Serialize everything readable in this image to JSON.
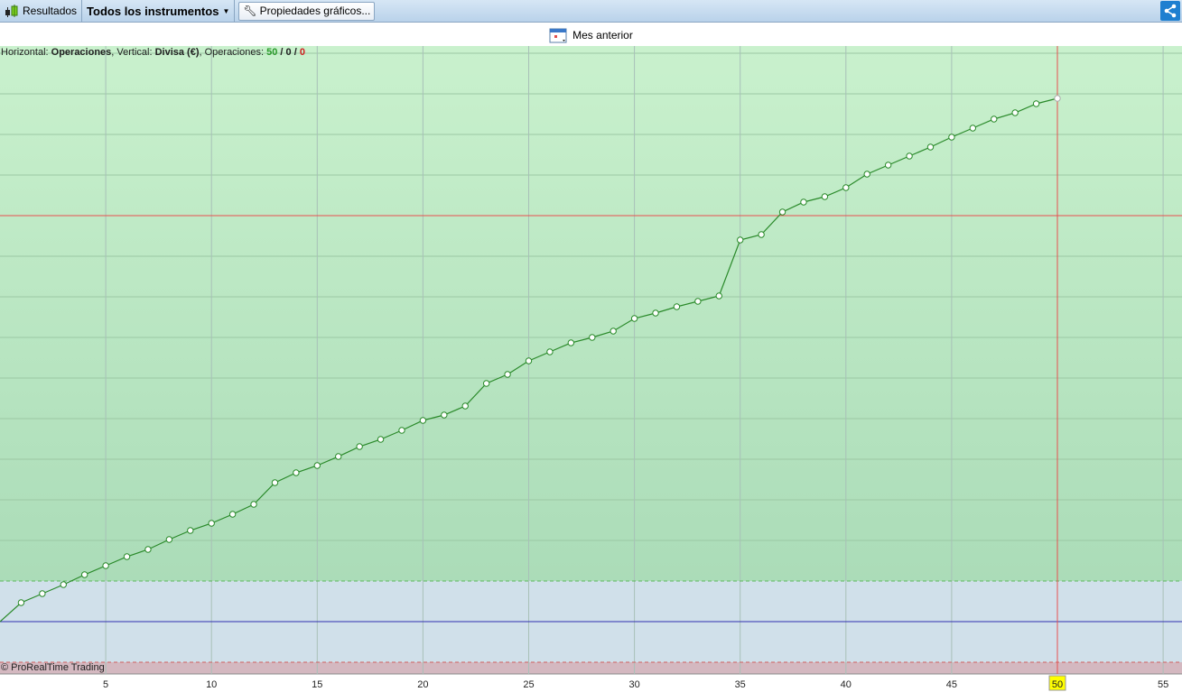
{
  "toolbar": {
    "results_label": "Resultados",
    "instruments_label": "Todos los instrumentos",
    "properties_label": "Propiedades gráficos...",
    "share_icon": "share-icon"
  },
  "subbar": {
    "period_label": "Mes anterior",
    "calendar_icon": "calendar-icon"
  },
  "info": {
    "h_prefix": "Horizontal: ",
    "h_value": "Operaciones",
    "v_prefix": ", Vertical: ",
    "v_value": "Divisa (€)",
    "ops_prefix": ", Operaciones: ",
    "ops_total": "50",
    "sep1": " / ",
    "ops_zero": "0",
    "sep2": " / ",
    "ops_loss": "0"
  },
  "copyright": "© ProRealTime Trading",
  "colors": {
    "line": "#2a8a2a",
    "upper_zone": "#c8f0cc",
    "lower_zone": "#d0e0ea",
    "loss_zone": "#d4b8c0",
    "crosshair": "#e85050",
    "zero_line": "#3030b0",
    "badge": "#ffff00"
  },
  "chart_data": {
    "type": "line",
    "xlabel": "",
    "ylabel": "",
    "xlim": [
      0,
      56
    ],
    "x_ticks": [
      5,
      10,
      15,
      20,
      25,
      30,
      35,
      40,
      45,
      50,
      55
    ],
    "x": [
      0,
      1,
      2,
      3,
      4,
      5,
      6,
      7,
      8,
      9,
      10,
      11,
      12,
      13,
      14,
      15,
      16,
      17,
      18,
      19,
      20,
      21,
      22,
      23,
      24,
      25,
      26,
      27,
      28,
      29,
      30,
      31,
      32,
      33,
      34,
      35,
      36,
      37,
      38,
      39,
      40,
      41,
      42,
      43,
      44,
      45,
      46,
      47,
      48,
      49,
      50
    ],
    "y": [
      0,
      21,
      31,
      41,
      52,
      62,
      72,
      80,
      91,
      101,
      109,
      119,
      130,
      154,
      165,
      173,
      183,
      194,
      202,
      212,
      223,
      229,
      239,
      264,
      274,
      289,
      299,
      309,
      315,
      322,
      336,
      342,
      349,
      355,
      361,
      423,
      429,
      454,
      465,
      471,
      481,
      496,
      506,
      516,
      526,
      537,
      547,
      557,
      564,
      574,
      580
    ],
    "ylim": [
      -58,
      638
    ],
    "grid": true,
    "crosshair_x": 50,
    "crosshair_y": 450,
    "zero_line": 0,
    "upper_threshold": 45,
    "lower_threshold": -45
  }
}
